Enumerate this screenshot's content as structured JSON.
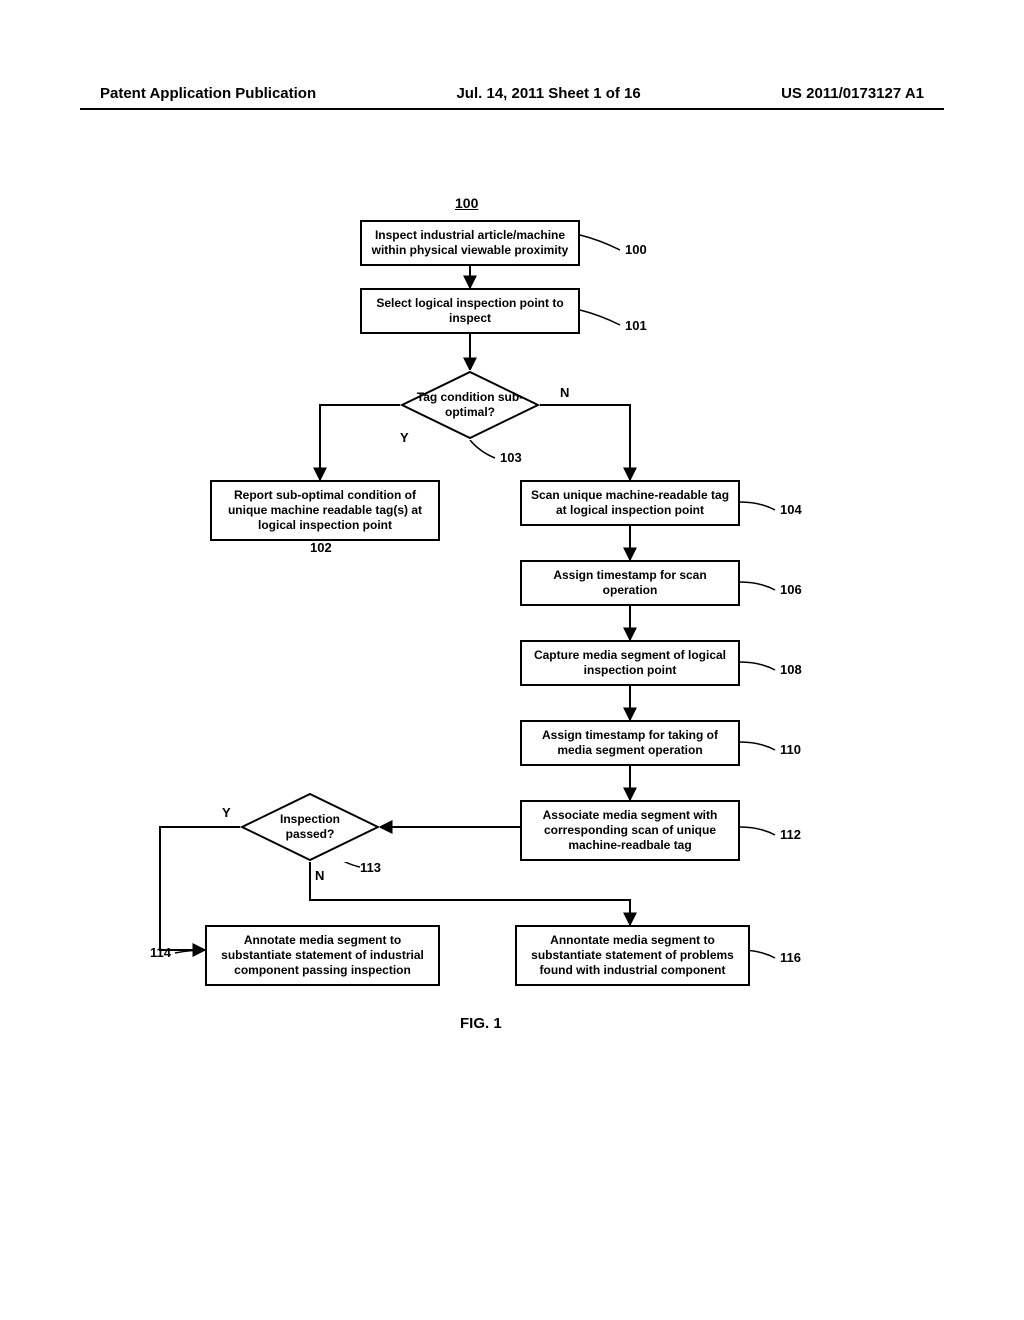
{
  "header": {
    "left": "Patent Application Publication",
    "center": "Jul. 14, 2011  Sheet 1 of 16",
    "right": "US 2011/0173127 A1"
  },
  "diagram": {
    "title_ref": "100",
    "caption": "FIG. 1",
    "nodes": {
      "n100": {
        "text": "Inspect industrial article/machine within physical viewable proximity",
        "ref": "100"
      },
      "n101": {
        "text": "Select logical inspection point to inspect",
        "ref": "101"
      },
      "d103": {
        "text": "Tag condition sub-optimal?",
        "ref": "103",
        "yes": "Y",
        "no": "N"
      },
      "n102": {
        "text": "Report sub-optimal condition of unique machine readable tag(s) at logical inspection point",
        "ref": "102"
      },
      "n104": {
        "text": "Scan unique machine-readable tag at logical inspection point",
        "ref": "104"
      },
      "n106": {
        "text": "Assign timestamp for scan operation",
        "ref": "106"
      },
      "n108": {
        "text": "Capture media segment of logical inspection point",
        "ref": "108"
      },
      "n110": {
        "text": "Assign timestamp for taking of media segment operation",
        "ref": "110"
      },
      "n112": {
        "text": "Associate media segment with corresponding scan of unique machine-readbale tag",
        "ref": "112"
      },
      "d113": {
        "text": "Inspection passed?",
        "ref": "113",
        "yes": "Y",
        "no": "N"
      },
      "n114": {
        "text": "Annotate media segment to substantiate statement of industrial component passing inspection",
        "ref": "114"
      },
      "n116": {
        "text": "Annontate media segment to substantiate statement of problems found with industrial component",
        "ref": "116"
      }
    }
  },
  "chart_data": {
    "type": "flowchart",
    "title": "FIG. 1 — Industrial inspection flow (ref 100)",
    "nodes": [
      {
        "id": "100",
        "type": "process",
        "text": "Inspect industrial article/machine within physical viewable proximity"
      },
      {
        "id": "101",
        "type": "process",
        "text": "Select logical inspection point to inspect"
      },
      {
        "id": "103",
        "type": "decision",
        "text": "Tag condition sub-optimal?"
      },
      {
        "id": "102",
        "type": "process",
        "text": "Report sub-optimal condition of unique machine readable tag(s) at logical inspection point"
      },
      {
        "id": "104",
        "type": "process",
        "text": "Scan unique machine-readable tag at logical inspection point"
      },
      {
        "id": "106",
        "type": "process",
        "text": "Assign timestamp for scan operation"
      },
      {
        "id": "108",
        "type": "process",
        "text": "Capture media segment of logical inspection point"
      },
      {
        "id": "110",
        "type": "process",
        "text": "Assign timestamp for taking of media segment operation"
      },
      {
        "id": "112",
        "type": "process",
        "text": "Associate media segment with corresponding scan of unique machine-readbale tag"
      },
      {
        "id": "113",
        "type": "decision",
        "text": "Inspection passed?"
      },
      {
        "id": "114",
        "type": "process",
        "text": "Annotate media segment to substantiate statement of industrial component passing inspection"
      },
      {
        "id": "116",
        "type": "process",
        "text": "Annontate media segment to substantiate statement of problems found with industrial component"
      }
    ],
    "edges": [
      {
        "from": "100",
        "to": "101"
      },
      {
        "from": "101",
        "to": "103"
      },
      {
        "from": "103",
        "to": "102",
        "label": "Y"
      },
      {
        "from": "103",
        "to": "104",
        "label": "N"
      },
      {
        "from": "104",
        "to": "106"
      },
      {
        "from": "106",
        "to": "108"
      },
      {
        "from": "108",
        "to": "110"
      },
      {
        "from": "110",
        "to": "112"
      },
      {
        "from": "112",
        "to": "113"
      },
      {
        "from": "113",
        "to": "114",
        "label": "Y"
      },
      {
        "from": "113",
        "to": "116",
        "label": "N"
      }
    ]
  }
}
